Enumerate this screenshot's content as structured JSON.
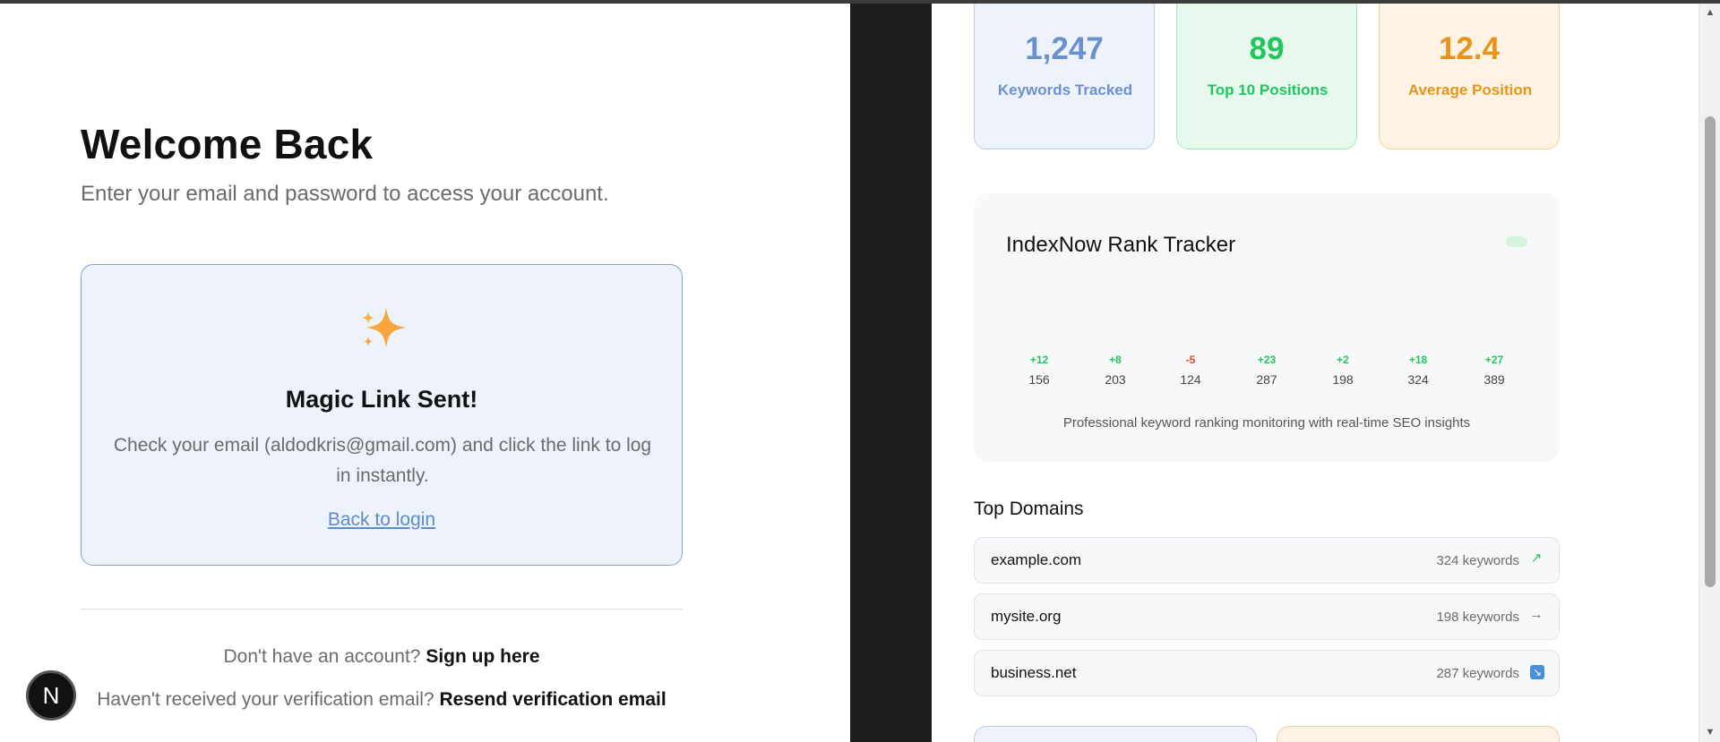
{
  "login": {
    "title": "Welcome Back",
    "subtitle": "Enter your email and password to access your account.",
    "magic_card": {
      "icon": "sparkles-icon",
      "title": "Magic Link Sent!",
      "message": "Check your email (aldodkris@gmail.com) and click the link to log in instantly.",
      "back_link": "Back to login"
    },
    "signup_prompt": "Don't have an account?",
    "signup_link": "Sign up here",
    "resend_prompt": "Haven't received your verification email?",
    "resend_link": "Resend verification email",
    "badge_letter": "N"
  },
  "preview": {
    "stats": [
      {
        "value": "1,247",
        "label": "Keywords Tracked",
        "color": "#6b90cf"
      },
      {
        "value": "89",
        "label": "Top 10 Positions",
        "color": "#22c55e"
      },
      {
        "value": "12.4",
        "label": "Average Position",
        "color": "#e6951a"
      }
    ],
    "tracker": {
      "title": "IndexNow Rank Tracker",
      "columns": [
        {
          "change": "+12",
          "value": "156"
        },
        {
          "change": "+8",
          "value": "203"
        },
        {
          "change": "-5",
          "value": "124"
        },
        {
          "change": "+23",
          "value": "287"
        },
        {
          "change": "+2",
          "value": "198"
        },
        {
          "change": "+18",
          "value": "324"
        },
        {
          "change": "+27",
          "value": "389"
        }
      ],
      "caption": "Professional keyword ranking monitoring with real-time SEO insights"
    },
    "domains_heading": "Top Domains",
    "domains": [
      {
        "name": "example.com",
        "keywords": "324 keywords",
        "trend_icon": "trend-up-icon",
        "trend_glyph": "↗"
      },
      {
        "name": "mysite.org",
        "keywords": "198 keywords",
        "trend_icon": "trend-flat-icon",
        "trend_glyph": "→"
      },
      {
        "name": "business.net",
        "keywords": "287 keywords",
        "trend_icon": "trend-down-icon",
        "trend_glyph": "↘"
      }
    ]
  }
}
